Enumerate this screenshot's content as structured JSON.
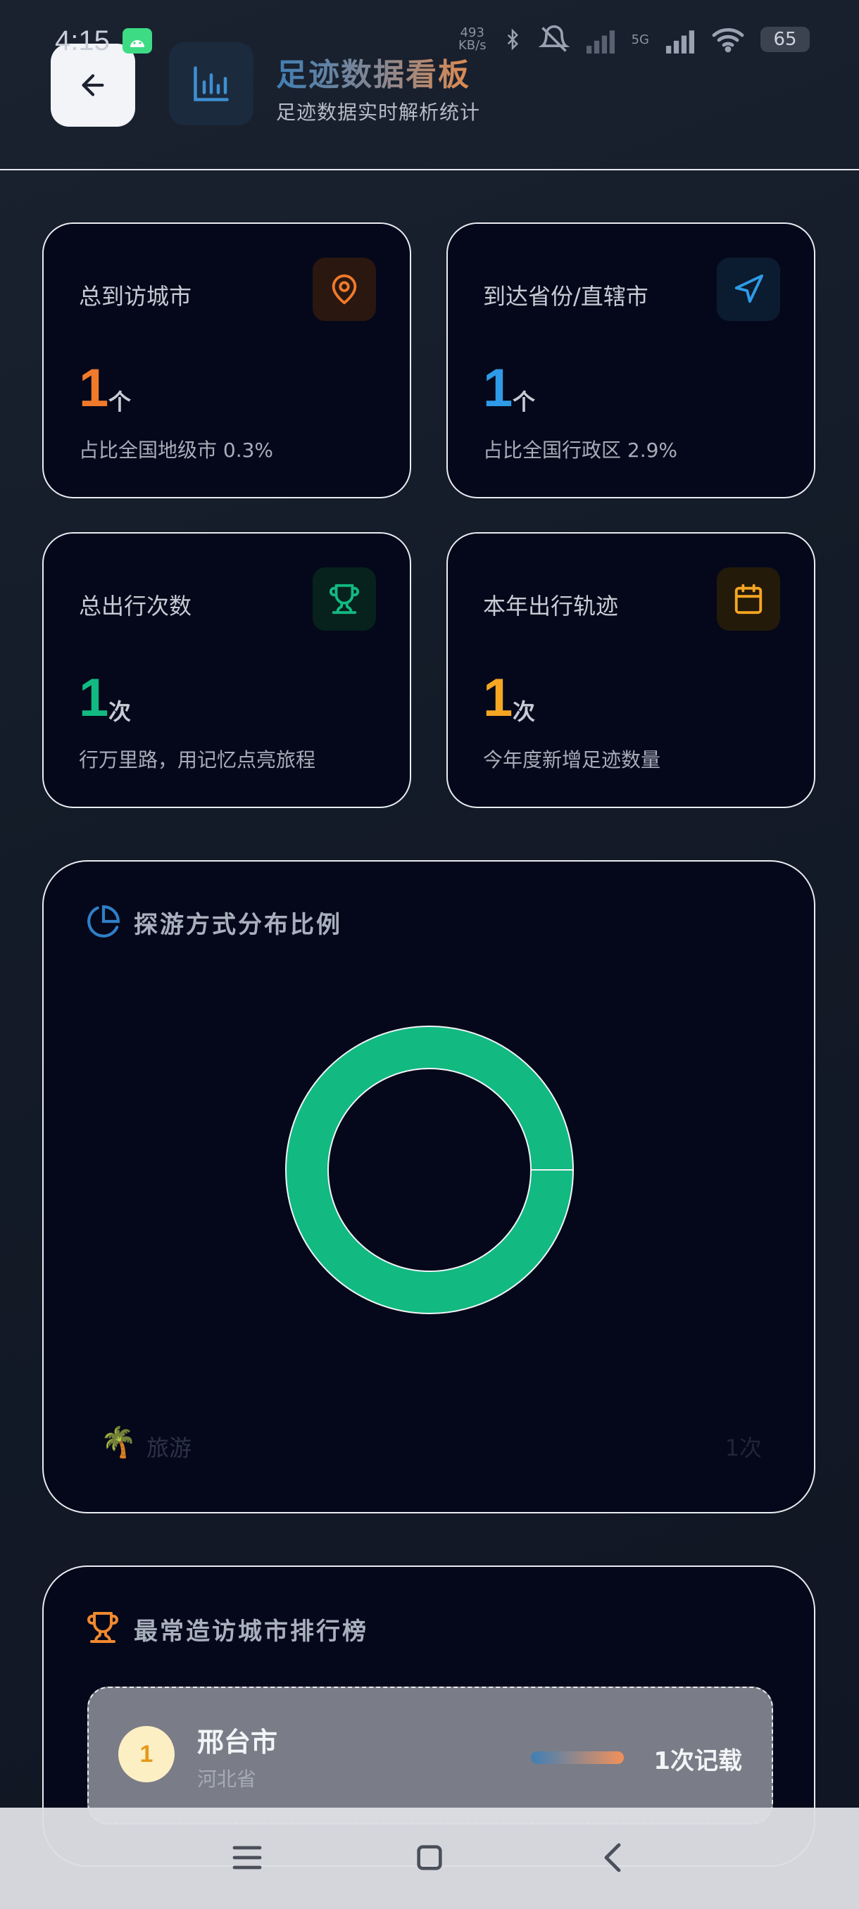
{
  "status": {
    "time": "4:15",
    "speed_value": "493",
    "speed_unit": "KB/s",
    "network": "5G",
    "battery": "65"
  },
  "header": {
    "title": "足迹数据看板",
    "subtitle": "足迹数据实时解析统计"
  },
  "cards": [
    {
      "label": "总到访城市",
      "value": "1",
      "unit": "个",
      "note": "占比全国地级市 0.3%",
      "accent": "#f07a2b",
      "icon": "map-pin-icon"
    },
    {
      "label": "到达省份/直辖市",
      "value": "1",
      "unit": "个",
      "note": "占比全国行政区 2.9%",
      "accent": "#2f9be8",
      "icon": "navigation-icon"
    },
    {
      "label": "总出行次数",
      "value": "1",
      "unit": "次",
      "note": "行万里路，用记忆点亮旅程",
      "accent": "#12b981",
      "icon": "trophy-icon"
    },
    {
      "label": "本年出行轨迹",
      "value": "1",
      "unit": "次",
      "note": "今年度新增足迹数量",
      "accent": "#f5a623",
      "icon": "calendar-icon"
    }
  ],
  "distribution": {
    "title": "探游方式分布比例",
    "legend": [
      {
        "emoji": "🌴",
        "label": "旅游",
        "value": "1次",
        "fraction": 1.0,
        "color": "#12b981"
      }
    ]
  },
  "ranking": {
    "title": "最常造访城市排行榜",
    "items": [
      {
        "rank": "1",
        "city": "邢台市",
        "province": "河北省",
        "count": "1次记载"
      }
    ]
  }
}
